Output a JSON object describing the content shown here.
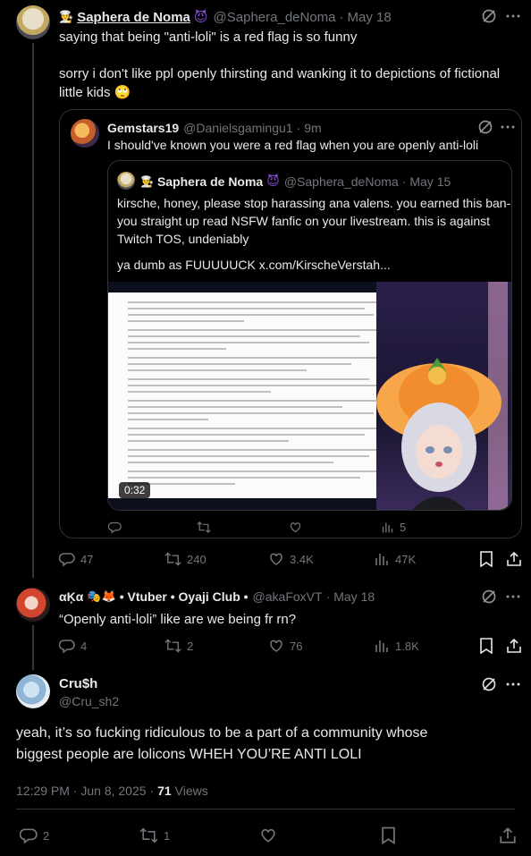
{
  "post1": {
    "display_name": "Saphera de Noma",
    "handle": "@Saphera_deNoma",
    "date": "May 18",
    "line1": "saying that being \"anti-loli\" is a red flag is so funny",
    "line2": "sorry i don't like ppl openly thirsting and wanking it to depictions of fictional",
    "line3": "little kids 🙄",
    "quote": {
      "display_name": "Gemstars19",
      "handle": "@Danielsgamingu1",
      "date": "9m",
      "text": "I should've known you were a red flag when you are openly anti-loli",
      "inner": {
        "display_name": "Saphera de Noma",
        "handle": "@Saphera_deNoma",
        "date": "May 15",
        "line1": "kirsche, honey, please stop harassing ana valens. you earned this ban-",
        "line2": "you straight up read NSFW fanfic on your livestream. this is against",
        "line3": "Twitch TOS, undeniably",
        "line4": "ya dumb as FUUUUUCK  x.com/KirscheVerstah...",
        "video_time": "0:32",
        "views": "5"
      }
    },
    "stats": {
      "replies": "47",
      "reposts": "240",
      "likes": "3.4K",
      "views": "47K"
    }
  },
  "post2": {
    "display_name": "αĶα",
    "name_suffix": "• Vtuber • Oyaji Club •",
    "handle": "@akaFoxVT",
    "date": "May 18",
    "text": "“Openly anti-loli” like are we being fr rn?",
    "stats": {
      "replies": "4",
      "reposts": "2",
      "likes": "76",
      "views": "1.8K"
    }
  },
  "post3": {
    "display_name": "Cru$h",
    "handle": "@Cru_sh2",
    "line1": "yeah, it’s so fucking ridiculous to be a part of a community whose",
    "line2": "biggest people are lolicons WHEH YOU’RE ANTI LOLI",
    "time": "12:29 PM · Jun 8, 2025 ·",
    "views_count": "71",
    "views_label": "Views",
    "stats": {
      "replies": "2",
      "reposts": "1"
    }
  },
  "colors": {
    "bg": "#000000",
    "text": "#e7e9ea",
    "muted": "#71767b",
    "border": "#2f3336"
  },
  "icons": [
    "grok-icon",
    "more-icon",
    "reply-icon",
    "repost-icon",
    "like-icon",
    "views-icon",
    "bookmark-icon",
    "share-icon",
    "play-icon",
    "laughing-devil-emoji",
    "eye-roll-emoji"
  ]
}
